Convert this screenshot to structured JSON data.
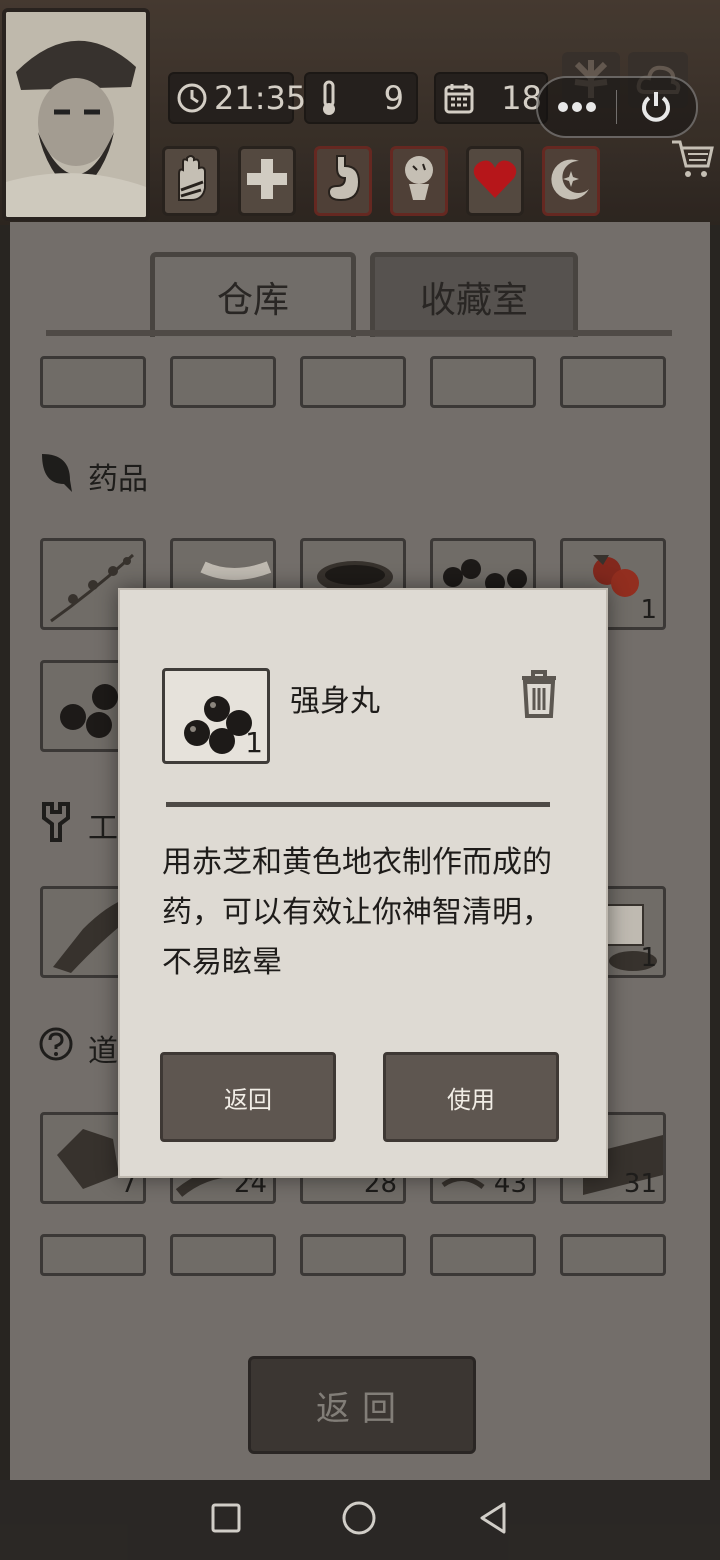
{
  "status": {
    "time": "21:35",
    "temperature": "9",
    "day": "18"
  },
  "tabs": [
    {
      "label": "仓库"
    },
    {
      "label": "收藏室"
    }
  ],
  "sections": {
    "medicine": "药品",
    "tools": "工",
    "items": "道"
  },
  "slots": {
    "medicine_row1_count5": "1",
    "tools_row_count5": "1",
    "items_row_counts": [
      "7",
      "24",
      "28",
      "43",
      "31"
    ]
  },
  "dialog": {
    "item_name": "强身丸",
    "item_count": "1",
    "description_lines": [
      "用赤芝和黄色地衣制作而成的",
      "药，可以有效让你神智清明，",
      "不易眩晕"
    ],
    "back_label": "返回",
    "use_label": "使用"
  },
  "bottom_button": "返回",
  "colors": {
    "paper": "#7d7873",
    "dialog_paper": "#dedad3",
    "button_brown": "#5e5650",
    "heart_red": "#c8161a"
  },
  "icons": [
    "clock-icon",
    "thermometer-icon",
    "calendar-icon",
    "leaf-icon",
    "cloud-icon",
    "more-icon",
    "power-icon",
    "cart-icon",
    "hand-icon",
    "plus-icon",
    "stomach-icon",
    "brain-icon",
    "heart-icon",
    "moon-icon",
    "trash-icon",
    "leaf-section-icon",
    "wrench-icon",
    "question-icon"
  ]
}
